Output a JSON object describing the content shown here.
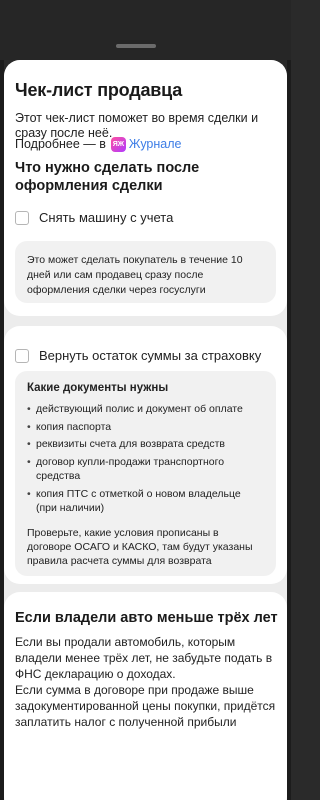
{
  "sheet": {
    "title": "Чек-лист продавца",
    "intro": "Этот чек-лист поможет во время сделки и сразу после неё.",
    "more_prefix": "Подробнее — в",
    "journal_badge": "ЯЖ",
    "journal_link": "Журнале",
    "subtitle": "Что нужно сделать после оформления сделки"
  },
  "checklist": {
    "item1": {
      "label": "Снять машину с учета",
      "checked": false,
      "info": "Это может сделать покупатель в течение 10 дней или сам продавец сразу после оформления сделки через госуслуги"
    },
    "item2": {
      "label": "Вернуть остаток суммы за страховку",
      "checked": false,
      "docs_title": "Какие документы нужны",
      "docs": [
        "действующий полис и документ об оплате",
        "копия паспорта",
        "реквизиты счета для возврата средств",
        "договор купли-продажи транспортного средства",
        "копия ПТС с отметкой о новом владельце (при наличии)"
      ],
      "note": "Проверьте, какие условия прописаны в договоре ОСАГО и КАСКО, там будут указаны правила расчета суммы для возврата"
    }
  },
  "tax_card": {
    "title": "Если владели авто меньше трёх лет",
    "paragraph1": "Если вы продали автомобиль, которым владели менее трёх лет, не забудьте подать в ФНС декларацию о доходах.",
    "paragraph2": "Если сумма в договоре при продаже выше задокументированной цены покупки, придётся заплатить налог с полученной прибыли"
  }
}
